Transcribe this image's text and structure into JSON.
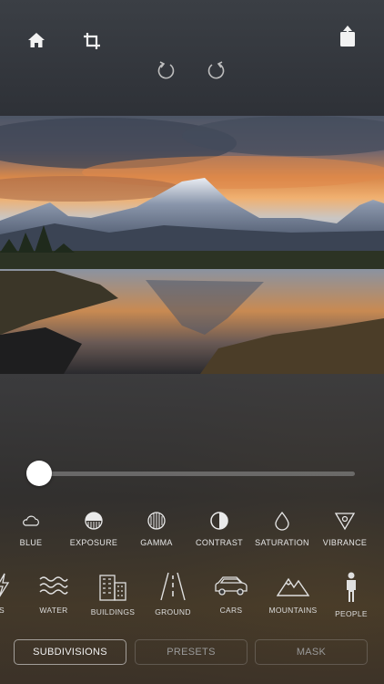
{
  "toolbar": {
    "home_icon": "home-icon",
    "crop_icon": "crop-icon",
    "share_icon": "share-icon",
    "undo_icon": "undo-icon",
    "redo_icon": "redo-icon"
  },
  "slider": {
    "value_fraction": 0.0
  },
  "adjustments": [
    {
      "label": "BLUE",
      "icon": "cloud-icon"
    },
    {
      "label": "EXPOSURE",
      "icon": "exposure-icon"
    },
    {
      "label": "GAMMA",
      "icon": "gamma-icon"
    },
    {
      "label": "CONTRAST",
      "icon": "contrast-icon"
    },
    {
      "label": "SATURATION",
      "icon": "drop-icon"
    },
    {
      "label": "VIBRANCE",
      "icon": "vibrance-icon"
    }
  ],
  "categories": [
    {
      "label": "S",
      "icon": "lightning-icon"
    },
    {
      "label": "WATER",
      "icon": "water-icon"
    },
    {
      "label": "BUILDINGS",
      "icon": "buildings-icon"
    },
    {
      "label": "GROUND",
      "icon": "road-icon"
    },
    {
      "label": "CARS",
      "icon": "car-icon"
    },
    {
      "label": "MOUNTAINS",
      "icon": "mountain-icon"
    },
    {
      "label": "PEOPLE",
      "icon": "person-icon"
    }
  ],
  "tabs": [
    {
      "label": "SUBDIVISIONS",
      "active": true
    },
    {
      "label": "PRESETS",
      "active": false
    },
    {
      "label": "MASK",
      "active": false
    }
  ]
}
